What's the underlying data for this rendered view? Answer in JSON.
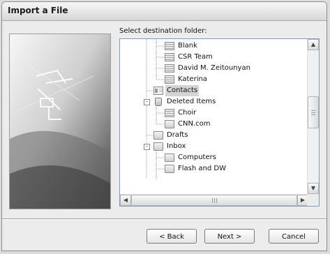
{
  "dialog": {
    "title": "Import a File",
    "prompt": "Select destination folder:"
  },
  "tree": {
    "items": [
      {
        "label": "Blank",
        "icon": "contacts-folder-icon"
      },
      {
        "label": "CSR Team",
        "icon": "contacts-folder-icon"
      },
      {
        "label": "David M. Zeitounyan",
        "icon": "contacts-folder-icon"
      },
      {
        "label": "Katerina",
        "icon": "contacts-folder-icon"
      },
      {
        "label": "Contacts",
        "icon": "contact-card-icon",
        "selected": true
      },
      {
        "label": "Deleted Items",
        "icon": "trash-icon",
        "expander": "-"
      },
      {
        "label": "Choir",
        "icon": "contacts-folder-icon"
      },
      {
        "label": "CNN.com",
        "icon": "folder-icon"
      },
      {
        "label": "Drafts",
        "icon": "folder-icon"
      },
      {
        "label": "Inbox",
        "icon": "folder-icon",
        "expander": "-"
      },
      {
        "label": "Computers",
        "icon": "folder-icon"
      },
      {
        "label": "Flash and DW",
        "icon": "folder-icon"
      }
    ]
  },
  "buttons": {
    "back": "< Back",
    "next": "Next >",
    "cancel": "Cancel"
  }
}
